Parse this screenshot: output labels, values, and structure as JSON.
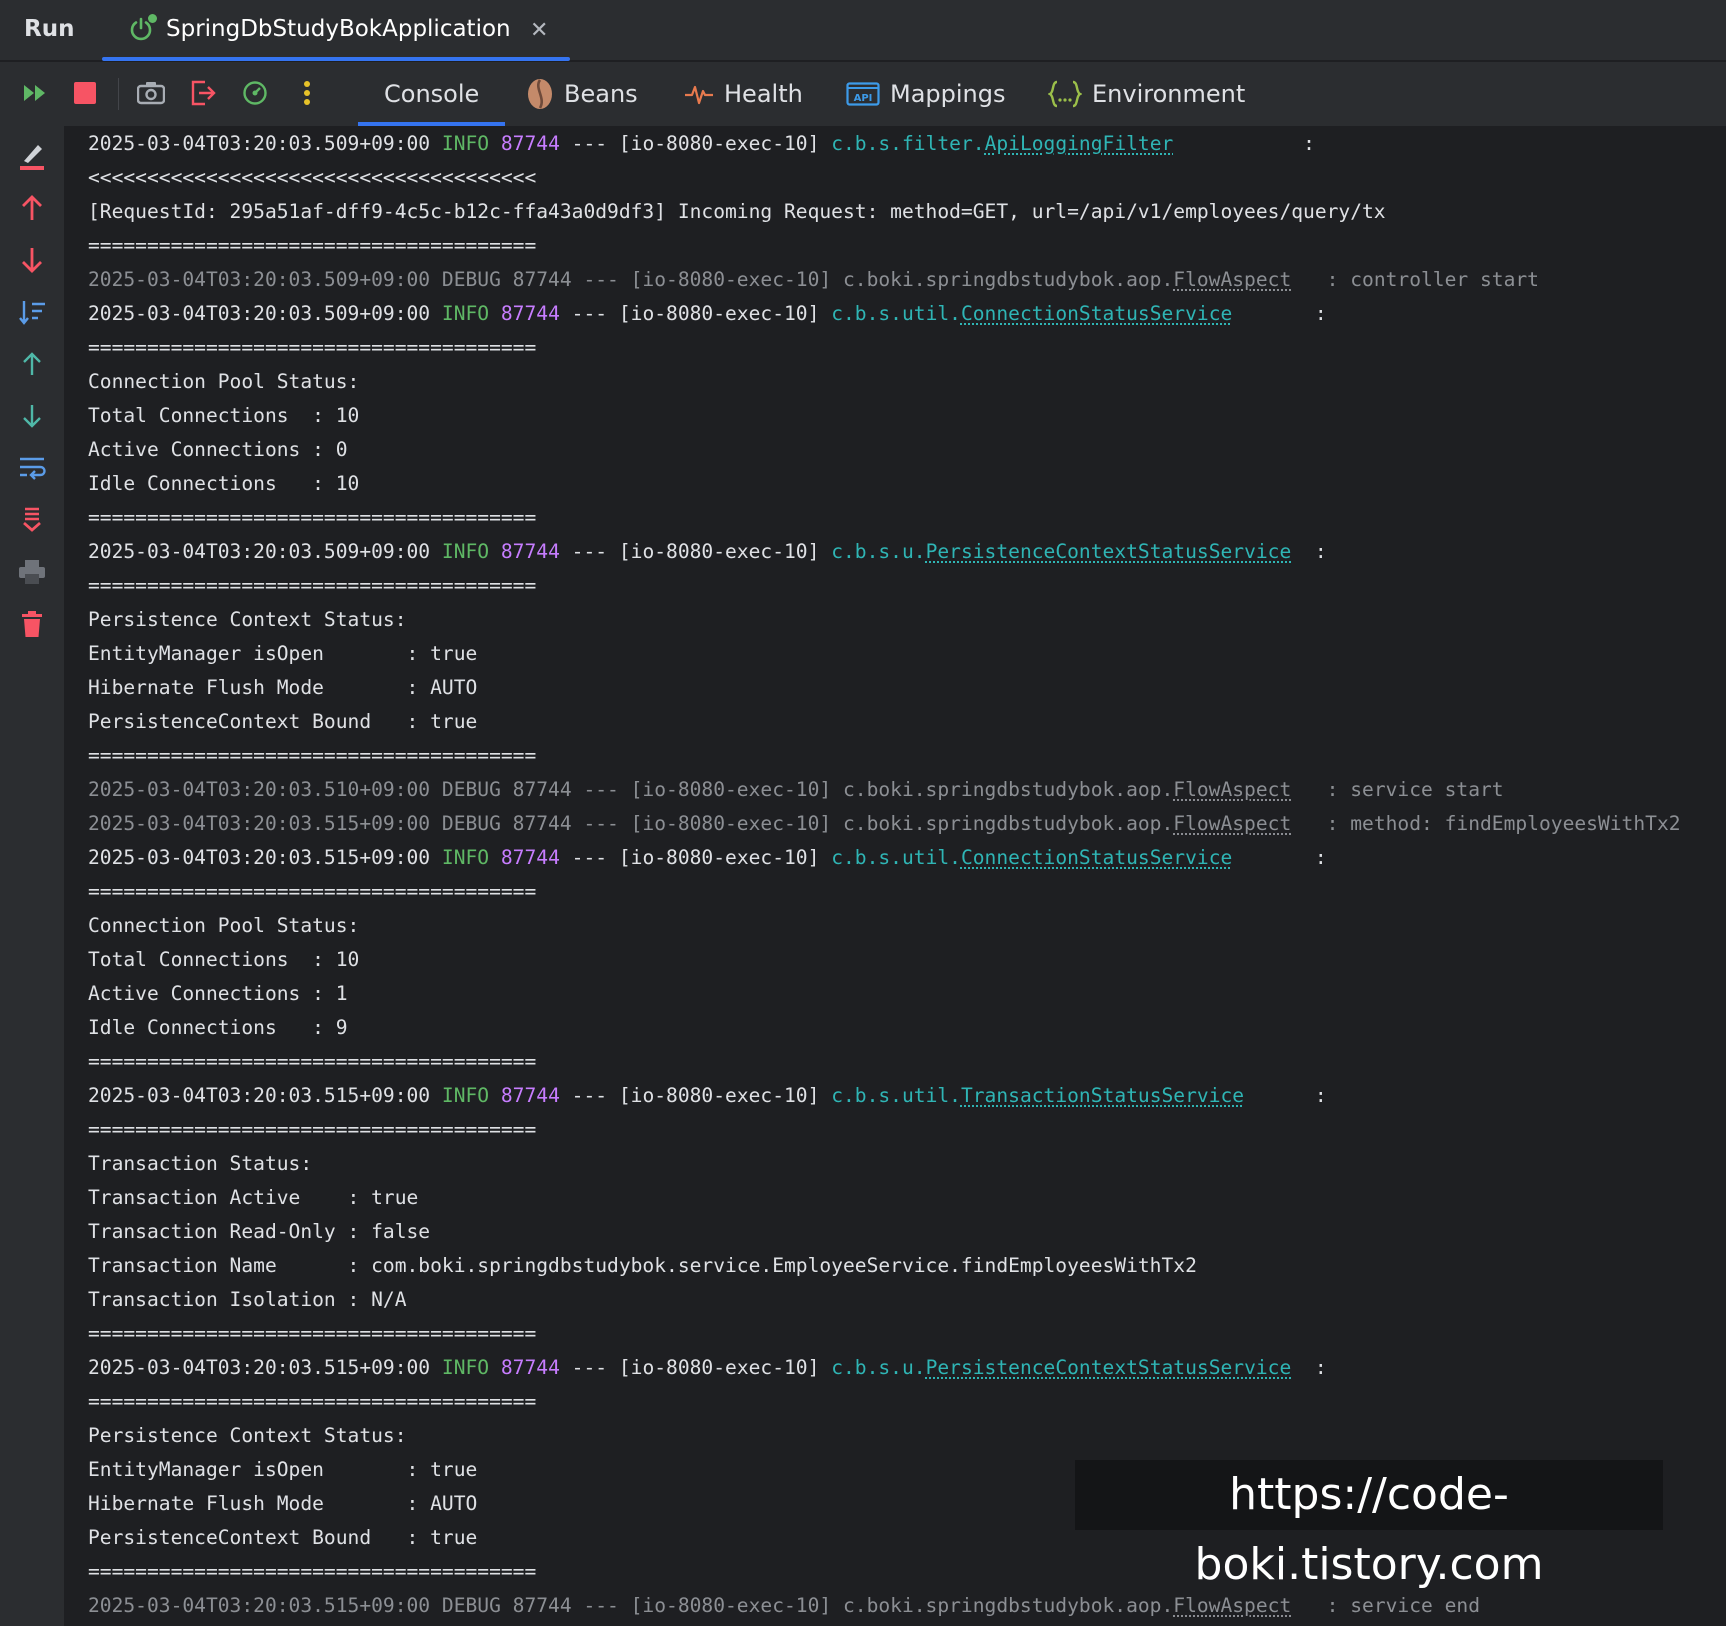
{
  "header": {
    "run_label": "Run",
    "tab_title": "SpringDbStudyBokApplication",
    "close_glyph": "✕"
  },
  "toolbar": {
    "tabs": [
      {
        "label": "Console",
        "icon": "console",
        "active": true
      },
      {
        "label": "Beans",
        "icon": "bean-icon"
      },
      {
        "label": "Health",
        "icon": "heartbeat-icon"
      },
      {
        "label": "Mappings",
        "icon": "api-icon",
        "icon_text": "API"
      },
      {
        "label": "Environment",
        "icon": "braces-icon"
      }
    ]
  },
  "colors": {
    "info": "#5fb865",
    "pid": "#c77dff",
    "logger": "#2fb5b5",
    "debug": "#8c8f94",
    "accent": "#3574f0",
    "stop": "#f75464"
  },
  "console": {
    "lines": [
      {
        "kind": "log",
        "level": "INFO",
        "ts": "2025-03-04T03:20:03.509+09:00",
        "lvl": " INFO",
        "pid": "87744",
        "thread": " --- [io-8080-exec-10] ",
        "pkg": "c.b.s.filter.",
        "cls": "ApiLoggingFilter",
        "pad": "           ",
        "msg": ":"
      },
      {
        "kind": "text",
        "text": "<<<<<<<<<<<<<<<<<<<<<<<<<<<<<<<<<<<<<<"
      },
      {
        "kind": "text",
        "text": "[RequestId: 295a51af-dff9-4c5c-b12c-ffa43a0d9df3] Incoming Request: method=GET, url=/api/v1/employees/query/tx"
      },
      {
        "kind": "text",
        "text": "======================================"
      },
      {
        "kind": "debug",
        "text_pre": "2025-03-04T03:20:03.509+09:00 DEBUG 87744 --- [io-8080-exec-10] c.boki.springdbstudybok.aop.",
        "cls": "FlowAspect",
        "text_post": "   : controller start"
      },
      {
        "kind": "log",
        "level": "INFO",
        "ts": "2025-03-04T03:20:03.509+09:00",
        "lvl": " INFO",
        "pid": "87744",
        "thread": " --- [io-8080-exec-10] ",
        "pkg": "c.b.s.util.",
        "cls": "ConnectionStatusService",
        "pad": "       ",
        "msg": ":"
      },
      {
        "kind": "text",
        "text": "======================================"
      },
      {
        "kind": "text",
        "text": "Connection Pool Status:"
      },
      {
        "kind": "text",
        "text": "Total Connections  : 10"
      },
      {
        "kind": "text",
        "text": "Active Connections : 0"
      },
      {
        "kind": "text",
        "text": "Idle Connections   : 10"
      },
      {
        "kind": "text",
        "text": "======================================"
      },
      {
        "kind": "log",
        "level": "INFO",
        "ts": "2025-03-04T03:20:03.509+09:00",
        "lvl": " INFO",
        "pid": "87744",
        "thread": " --- [io-8080-exec-10] ",
        "pkg": "c.b.s.u.",
        "cls": "PersistenceContextStatusService",
        "pad": "  ",
        "msg": ":"
      },
      {
        "kind": "text",
        "text": "======================================"
      },
      {
        "kind": "text",
        "text": "Persistence Context Status:"
      },
      {
        "kind": "text",
        "text": "EntityManager isOpen       : true"
      },
      {
        "kind": "text",
        "text": "Hibernate Flush Mode       : AUTO"
      },
      {
        "kind": "text",
        "text": "PersistenceContext Bound   : true"
      },
      {
        "kind": "text",
        "text": "======================================"
      },
      {
        "kind": "debug",
        "text_pre": "2025-03-04T03:20:03.510+09:00 DEBUG 87744 --- [io-8080-exec-10] c.boki.springdbstudybok.aop.",
        "cls": "FlowAspect",
        "text_post": "   : service start"
      },
      {
        "kind": "debug",
        "text_pre": "2025-03-04T03:20:03.515+09:00 DEBUG 87744 --- [io-8080-exec-10] c.boki.springdbstudybok.aop.",
        "cls": "FlowAspect",
        "text_post": "   : method: findEmployeesWithTx2"
      },
      {
        "kind": "log",
        "level": "INFO",
        "ts": "2025-03-04T03:20:03.515+09:00",
        "lvl": " INFO",
        "pid": "87744",
        "thread": " --- [io-8080-exec-10] ",
        "pkg": "c.b.s.util.",
        "cls": "ConnectionStatusService",
        "pad": "       ",
        "msg": ":"
      },
      {
        "kind": "text",
        "text": "======================================"
      },
      {
        "kind": "text",
        "text": "Connection Pool Status:"
      },
      {
        "kind": "text",
        "text": "Total Connections  : 10"
      },
      {
        "kind": "text",
        "text": "Active Connections : 1"
      },
      {
        "kind": "text",
        "text": "Idle Connections   : 9"
      },
      {
        "kind": "text",
        "text": "======================================"
      },
      {
        "kind": "log",
        "level": "INFO",
        "ts": "2025-03-04T03:20:03.515+09:00",
        "lvl": " INFO",
        "pid": "87744",
        "thread": " --- [io-8080-exec-10] ",
        "pkg": "c.b.s.util.",
        "cls": "TransactionStatusService",
        "pad": "      ",
        "msg": ":"
      },
      {
        "kind": "text",
        "text": "======================================"
      },
      {
        "kind": "text",
        "text": "Transaction Status:"
      },
      {
        "kind": "text",
        "text": "Transaction Active    : true"
      },
      {
        "kind": "text",
        "text": "Transaction Read-Only : false"
      },
      {
        "kind": "text",
        "text": "Transaction Name      : com.boki.springdbstudybok.service.EmployeeService.findEmployeesWithTx2"
      },
      {
        "kind": "text",
        "text": "Transaction Isolation : N/A"
      },
      {
        "kind": "text",
        "text": "======================================"
      },
      {
        "kind": "log",
        "level": "INFO",
        "ts": "2025-03-04T03:20:03.515+09:00",
        "lvl": " INFO",
        "pid": "87744",
        "thread": " --- [io-8080-exec-10] ",
        "pkg": "c.b.s.u.",
        "cls": "PersistenceContextStatusService",
        "pad": "  ",
        "msg": ":"
      },
      {
        "kind": "text",
        "text": "======================================"
      },
      {
        "kind": "text",
        "text": "Persistence Context Status:"
      },
      {
        "kind": "text",
        "text": "EntityManager isOpen       : true"
      },
      {
        "kind": "text",
        "text": "Hibernate Flush Mode       : AUTO"
      },
      {
        "kind": "text",
        "text": "PersistenceContext Bound   : true"
      },
      {
        "kind": "text",
        "text": "======================================"
      },
      {
        "kind": "debug",
        "text_pre": "2025-03-04T03:20:03.515+09:00 DEBUG 87744 --- [io-8080-exec-10] c.boki.springdbstudybok.aop.",
        "cls": "FlowAspect",
        "text_post": "   : service end"
      }
    ]
  },
  "watermark": "https://code-boki.tistory.com"
}
